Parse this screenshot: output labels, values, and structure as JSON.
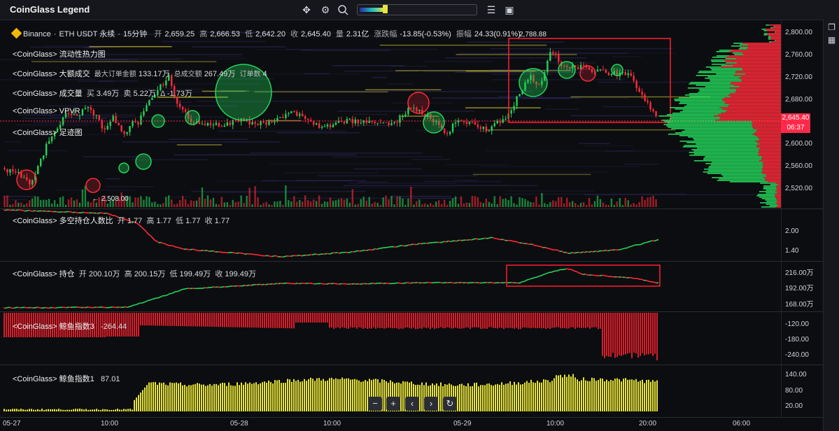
{
  "app_title": "CoinGlass Legend",
  "toolbar": {
    "icons": [
      "crosshair-icon",
      "settings-gear-icon",
      "search-icon",
      "filter-icon",
      "screenshot-icon"
    ],
    "heatmap_slider_value": 0.2
  },
  "symbol": {
    "exchange": "Binance",
    "pair": "ETH USDT 永续",
    "interval": "15分钟",
    "open_label": "开",
    "open": "2,659.25",
    "high_label": "高",
    "high": "2,666.53",
    "low_label": "低",
    "low": "2,642.20",
    "close_label": "收",
    "close": "2,645.40",
    "vol_label": "量",
    "vol": "2.31亿",
    "chg_label": "涨跌幅",
    "chg": "-13.85(-0.53%)",
    "amp_label": "振幅",
    "amp": "24.33(0.91%)"
  },
  "main_legends": [
    {
      "label": "<CoinGlass> 流动性热力图"
    },
    {
      "label": "<CoinGlass> 大额成交",
      "extra1": "最大订单金额",
      "v1": "133.17万",
      "extra2": "总成交额",
      "v2": "267.49万",
      "extra3": "订单数",
      "v3": "4"
    },
    {
      "label": "<CoinGlass> 成交量",
      "extra1": "买",
      "v1": "3.49万",
      "extra2": "卖",
      "v2": "5.22万",
      "extra3": "Δ",
      "v3": "-1.73万"
    },
    {
      "label": "<CoinGlass> VPVR"
    },
    {
      "label": "<CoinGlass> 足迹图"
    }
  ],
  "price_axis": [
    "2,800.00",
    "2,760.00",
    "2,720.00",
    "2,680.00",
    "2,640.00",
    "2,600.00",
    "2,560.00",
    "2,520.00"
  ],
  "price_tag": {
    "price": "2,645.40",
    "countdown": "06:37"
  },
  "high_marker": "2,788.88",
  "low_marker": "2,508.00",
  "ls_ratio": {
    "label": "<CoinGlass> 多空持仓人数比",
    "o_label": "开",
    "o": "1.77",
    "h_label": "高",
    "h": "1.77",
    "l_label": "低",
    "l": "1.77",
    "c_label": "收",
    "c": "1.77",
    "axis": [
      "2.00",
      "1.40"
    ]
  },
  "open_interest": {
    "label": "<CoinGlass> 持仓",
    "o_label": "开",
    "o": "200.10万",
    "h_label": "高",
    "h": "200.15万",
    "l_label": "低",
    "l": "199.49万",
    "c_label": "收",
    "c": "199.49万",
    "axis": [
      "216.00万",
      "192.00万",
      "168.00万"
    ]
  },
  "whale3": {
    "label": "<CoinGlass> 鲸鱼指数3",
    "value": "-264.44",
    "axis": [
      "-120.00",
      "-180.00",
      "-240.00"
    ]
  },
  "whale1": {
    "label": "<CoinGlass> 鲸鱼指数1",
    "value": "87.01",
    "axis": [
      "140.00",
      "80.00",
      "20.00"
    ]
  },
  "time_axis": [
    "05-27",
    "10:00",
    "05-28",
    "10:00",
    "05-29",
    "10:00",
    "20:00",
    "06:00"
  ],
  "nav": [
    "−",
    "+",
    "‹",
    "›",
    "↻"
  ],
  "colors": {
    "up": "#23d45a",
    "down": "#ff2a3a",
    "whale1": "#e6e43a",
    "box": "#ff1f2f",
    "price_tag": "#ff2a4a"
  }
}
